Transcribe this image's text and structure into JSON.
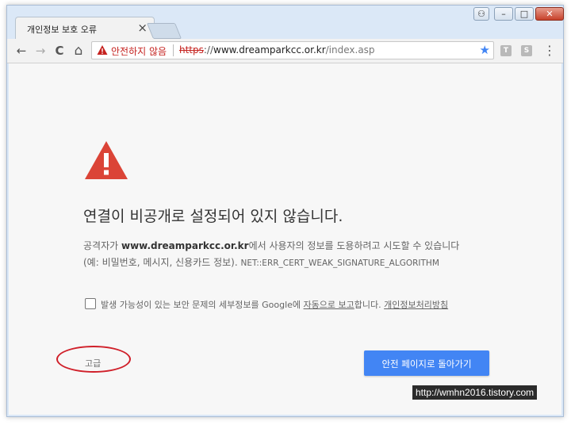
{
  "browser": {
    "tab_title": "개인정보 보호 오류",
    "tab_close": "×",
    "window_controls": {
      "user": "⚇",
      "minimize": "–",
      "maximize": "□",
      "close": "✕"
    },
    "nav": {
      "back": "←",
      "forward": "→",
      "reload": "C",
      "home": "⌂"
    },
    "address": {
      "security_label": "안전하지 않음",
      "scheme": "https",
      "rest": "://",
      "host": "www.dreamparkcc.or.kr",
      "path": "/index.asp"
    },
    "bookmark_star": "★",
    "extensions": [
      "T",
      "S"
    ],
    "menu": "⋮"
  },
  "page": {
    "heading": "연결이 비공개로 설정되어 있지 않습니다.",
    "desc_prefix": "공격자가 ",
    "desc_host": "www.dreamparkcc.or.kr",
    "desc_suffix": "에서 사용자의 정보를 도용하려고 시도할 수 있습니다",
    "desc_line2": "(예: 비밀번호, 메시지, 신용카드 정보). ",
    "error_code": "NET::ERR_CERT_WEAK_SIGNATURE_ALGORITHM",
    "checkbox_text_prefix": "발생 가능성이 있는 보안 문제의 세부정보를 Google에 ",
    "checkbox_link": "자동으로 보고",
    "checkbox_text_mid": "합니다. ",
    "privacy_link": "개인정보처리방침",
    "advanced_label": "고급",
    "back_button": "안전 페이지로 돌아가기"
  },
  "watermark": "http://wmhn2016.tistory.com",
  "colors": {
    "warning_red": "#db4437",
    "button_blue": "#4285f4",
    "annotation_red": "#d0202a"
  }
}
